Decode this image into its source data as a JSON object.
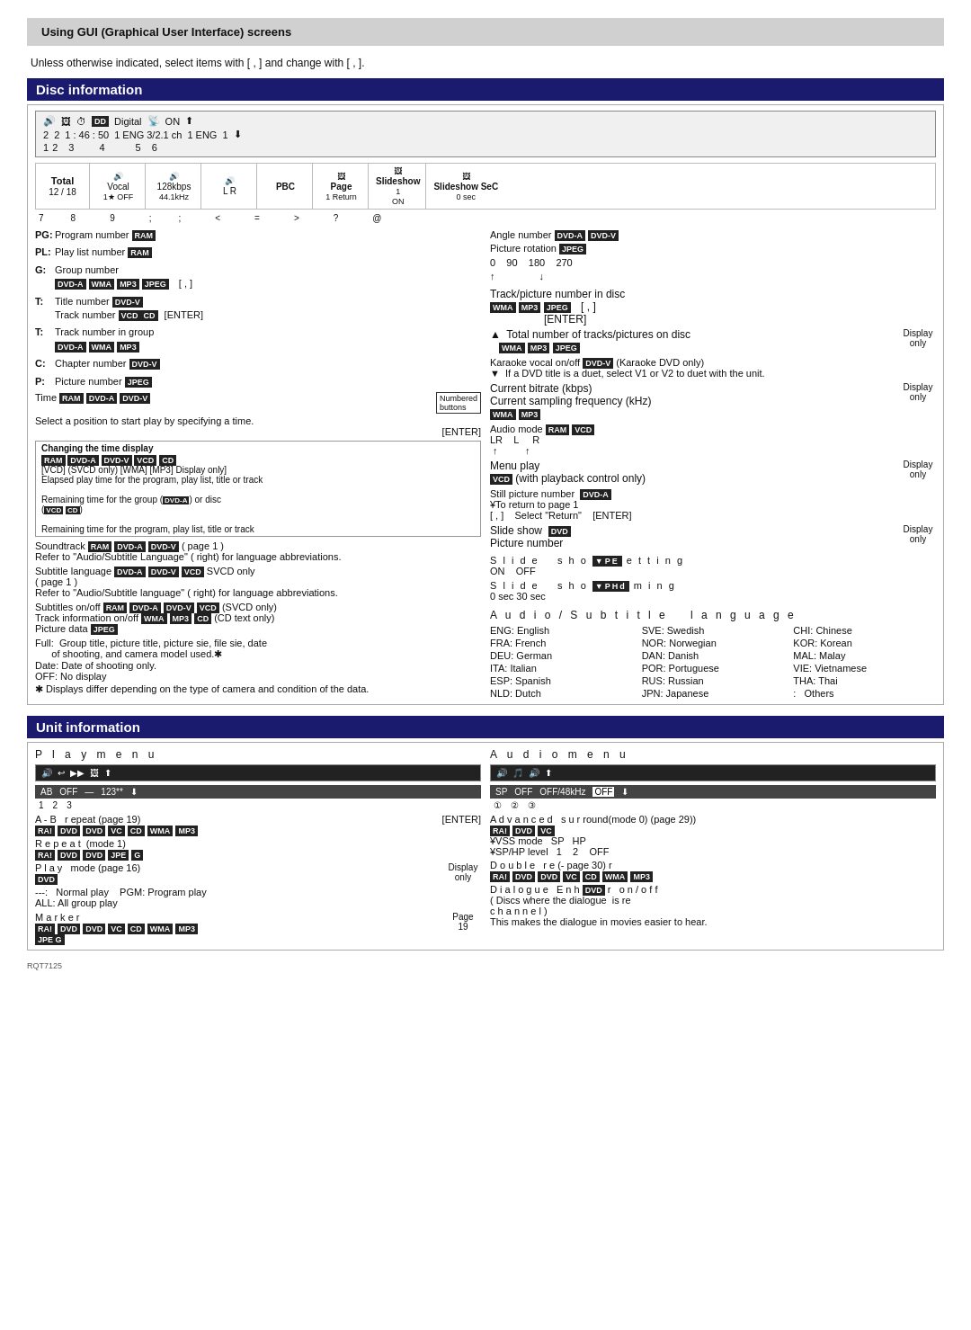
{
  "page": {
    "top_heading": "Using GUI (Graphical User Interface) screens",
    "intro": "Unless otherwise indicated, select items with [   ,   ] and change with [  ,  ].",
    "disc_info_title": "Disc information",
    "unit_info_title": "Unit information",
    "rqt": "RQT7125"
  },
  "disc_header": {
    "icons_row": "🔊  🖼  ⏱  DD Digital  📡  ON  ⬆",
    "row2": "2  2  1:46:50  1 ENG 3/2.1 ch  1 ENG  1  ⬇",
    "numbers": "1  2  3  4  5  6"
  },
  "toolbar": {
    "total_label": "Total",
    "total_value": "12 / 18",
    "vocal": "Vocal",
    "vocal_sub": "1★ OFF",
    "bitrate": "128kbps",
    "freq": "44.1kHz",
    "lr": "L R",
    "pbc": "PBC",
    "page_label": "Page",
    "page_val": "1 Return",
    "slideshow1_label": "Slideshow",
    "slideshow1_val": "1",
    "slideshow1_onoff": "ON",
    "slideshow2_label": "Slideshow SeC",
    "slideshow2_val": "0 sec",
    "numbers2": "7  8  9  ;  ;  <  =  >  ?  @"
  },
  "left_col": {
    "items": [
      {
        "label": "PG:",
        "text": "Program number",
        "badge": "RAM"
      },
      {
        "label": "PL:",
        "text": "Play list number",
        "badge": "RAM"
      },
      {
        "label": "G:",
        "text": "Group number",
        "badges": [
          "DVD-A",
          "WMA",
          "MP3",
          "JPEG"
        ],
        "extra": "[  ,  ]"
      },
      {
        "label": "T:",
        "text": "Title number",
        "badge": "DVD-V",
        "extra2": "Track number",
        "badges2": [
          "VCD",
          "CD"
        ],
        "enter": "[ENTER]"
      },
      {
        "label": "T:",
        "text": "Track number in group",
        "badges": [
          "DVD-A",
          "WMA",
          "MP3"
        ]
      },
      {
        "label": "C:",
        "text": "Chapter number",
        "badge": "DVD-V"
      },
      {
        "label": "P:",
        "text": "Picture number",
        "badge": "JPEG"
      }
    ],
    "time_label": "Time",
    "time_badges": [
      "RAM",
      "DVD-A",
      "DVD-V"
    ],
    "time_numbered": "Numbered buttons",
    "time_select": "Select a position to start play by specifying a time.",
    "time_enter": "[ENTER]",
    "changing_label": "Changing the time display",
    "changing_badges": [
      "RAM",
      "DVD-A",
      "DVD-V",
      "VCD",
      "CD"
    ],
    "svcd_only": "[VCD] (SVCD only) [WMA] [MP3] Display only]",
    "elapsed": "Elapsed play time for the program, play list, title or track",
    "remaining_group": "Remaining time for the group (DVD-A) or disc",
    "remaining_group_badges": [
      "VCD",
      "CD"
    ],
    "remaining_track": "Remaining time for the program, play list, title or track",
    "soundtrack_label": "Soundtrack",
    "soundtrack_badges": [
      "RAM",
      "DVD-A",
      "DVD-V"
    ],
    "soundtrack_page": "( page 1 )",
    "soundtrack_refer": "Refer to \"Audio/Subtitle Language\" ( right) for language abbreviations.",
    "subtitle_label": "Subtitle language",
    "subtitle_badges": [
      "DVD-A",
      "DVD-V",
      "VCD"
    ],
    "subtitle_svcd": "SVCD only",
    "subtitle_page": "( page 1 )",
    "subtitle_refer": "Refer to \"Audio/Subtitle language\" ( right) for language abbreviations.",
    "subtitles_onoff": "Subtitles on/off",
    "subtitles_badges": [
      "RAM",
      "DVD-A",
      "DVD-V",
      "VCD"
    ],
    "subtitles_svcd": "SVCD only",
    "track_info": "Track information on/off",
    "track_badges": [
      "WMA",
      "MP3",
      "CD"
    ],
    "track_text": "CD text only",
    "picture_label": "Picture data",
    "picture_badge": "JPEG",
    "full_label": "Full:",
    "full_text": "Group title, picture title, picture si​e, file si​e, date of shooting, and camera model used.✱",
    "date_label": "Date:",
    "date_text": "Date of shooting only.",
    "off_label": "OFF:",
    "off_text": "No display",
    "asterisk_note": "✱ Displays differ depending on the type of camera and condition of the data."
  },
  "right_col": {
    "angle_label": "Angle number",
    "angle_badges": [
      "DVD-A",
      "DVD-V"
    ],
    "rotation_label": "Picture rotation",
    "rotation_badge": "JPEG",
    "rotation_values": "0  90  180  270",
    "rotation_arrows": "↑        ↓",
    "track_disc_label": "Track/picture number in disc",
    "track_disc_badges": [
      "WMA",
      "MP3",
      "JPEG"
    ],
    "track_disc_bracket": "[  ,  ]",
    "track_disc_enter": "[ENTER]",
    "total_tracks_label": "Total number of tracks/pictures on disc",
    "total_tracks_badges": [
      "WMA",
      "MP3",
      "JPEG"
    ],
    "total_tracks_display": "Display only",
    "karaoke_label": "Karaoke vocal on/off",
    "karaoke_badge": "DVD-V",
    "karaoke_text": "(Karaoke DVD only)",
    "karaoke_sub": "If a DVD title is a duet, select V1 or V2 to duet with the unit.",
    "bitrate_label": "Current bitrate (kbps)",
    "freq_label": "Current sampling frequency (kHz)",
    "bitrate_badges": [
      "WMA",
      "MP3"
    ],
    "bitrate_display": "Display only",
    "audio_mode_label": "Audio mode",
    "audio_mode_badges": [
      "RAM",
      "VCD"
    ],
    "audio_mode_lr": "LR  L  R",
    "audio_mode_arrows": "↑      ↑",
    "menu_label": "Menu play",
    "menu_badge": "VCD",
    "menu_sub": "(with playback control only)",
    "menu_display": "Display only",
    "still_label": "Still picture number",
    "still_badge": "DVD-A",
    "still_return": "¥To return to page 1",
    "still_bracket": "[  ,  ]",
    "still_select": "Select \"Return\"  [ENTER]",
    "slide_show_label": "Slide show",
    "slide_show_badge": "DVD",
    "slide_show_pic": "Picture number",
    "slide_show_display": "Display only",
    "slide_setting_spaced": "S l i d e   s h o w  Setting",
    "slide_setting_values": "ON  OFF",
    "slide_timing_spaced": "S l i d e   s h o w  timing",
    "slide_timing_values": "0 sec 30 sec",
    "audio_subtitle_title": "Audio/Subtitle language",
    "languages": [
      [
        "ENG: English",
        "SVE: Swedish",
        "CHI: Chinese"
      ],
      [
        "FRA: French",
        "NOR: Norwegian",
        "KOR: Korean"
      ],
      [
        "DEU: German",
        "DAN: Danish",
        "MAL: Malay"
      ],
      [
        "ITA: Italian",
        "POR: Portuguese",
        "VIE: Vietnamese"
      ],
      [
        "ESP: Spanish",
        "RUS: Russian",
        "THA: Thai"
      ],
      [
        "NLD: Dutch",
        "JPN: Japanese",
        ":  Others"
      ]
    ]
  },
  "play_menu": {
    "title": "P l a y   m e n u",
    "toolbar_icons": "🔊 ↩ ▶▶ 🖼 ⬆",
    "toolbar_sub": "AB OFF — 123** ⬇",
    "toolbar_nums": "1  2  3",
    "ab_label": "A - B  repeat (page 19)",
    "ab_badges": [
      "RA!",
      "DVD",
      "DVD",
      "VC",
      "CD",
      "WMA",
      "MP3"
    ],
    "ab_enter": "[ENTER]",
    "repeat_label": "Repeat (mode 1)",
    "repeat_badges": [
      "RA!",
      "DVD",
      "DVD",
      "JPE",
      "G"
    ],
    "play_label": "Play mode (page 16)",
    "play_badge": "DVD",
    "play_display": "Display only",
    "play_normal": "---:  Normal play",
    "play_pgm": "PGM: Program play",
    "play_all": "ALL: All group play",
    "marker_label": "Marker",
    "marker_badges": [
      "RA!",
      "DVD",
      "DVD",
      "VC",
      "CD",
      "WMA",
      "MP3"
    ],
    "marker_badge2": "JPE G",
    "marker_page": "Page 19"
  },
  "audio_menu": {
    "title": "A u d i o   m e n u",
    "toolbar_icons": "🔊  🎵  🔊  ⬆",
    "toolbar_sub": "SP  OFF  OFF/48kHz  OFF  ⬇",
    "toolbar_nums": "①  ②  ③",
    "advanced_label": "Advanced surround (mode 0) (page 29))",
    "advanced_badges": [
      "RA!",
      "DVD",
      "VC"
    ],
    "vss_label": "¥VSS mode  SP  HP",
    "sp_label": "¥SP/HP level  1  2  OFF",
    "double_label": "Double re (- page 30) r",
    "double_badges": [
      "RA!",
      "DVD",
      "DVD",
      "VC",
      "CD",
      "WMA",
      "MP3"
    ],
    "dialogue_label": "Dialogue Enh DVD-r on/off",
    "dialogue_sub": "( Discs where the dialogue is re channel )",
    "dialogue_note": "This makes the dialogue in movies easier to hear."
  }
}
